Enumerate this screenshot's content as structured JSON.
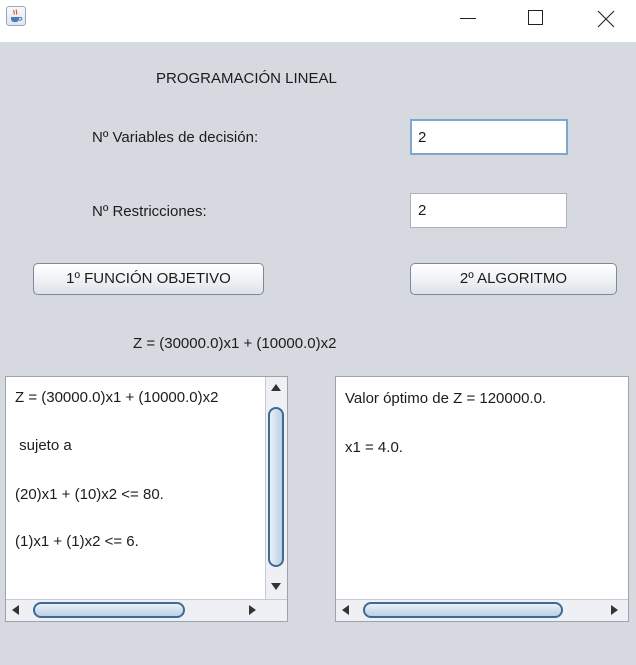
{
  "window": {
    "icon": "java-coffee-cup-icon",
    "controls": [
      "minimize-icon",
      "maximize-icon",
      "close-icon"
    ]
  },
  "form": {
    "title": "PROGRAMACIÓN LINEAL",
    "variables_label": "Nº Variables de decisión:",
    "variables_value": "2",
    "restrictions_label": "Nº Restricciones:",
    "restrictions_value": "2",
    "objective_button": "1º FUNCIÓN OBJETIVO",
    "algorithm_button": "2º ALGORITMO",
    "objective_function": "Z =  (30000.0)x1 + (10000.0)x2"
  },
  "model_panel": {
    "lines": [
      "Z = (30000.0)x1 + (10000.0)x2",
      " sujeto a",
      "(20)x1 + (10)x2 <= 80.",
      "(1)x1 + (1)x2 <= 6."
    ]
  },
  "result_panel": {
    "lines": [
      "Valor óptimo de Z = 120000.0.",
      "x1 = 4.0."
    ]
  },
  "colors": {
    "window_bg": "#d6d9df",
    "focus_border": "#7ea6cf",
    "scroll_thumb_border": "#3f6a95"
  }
}
